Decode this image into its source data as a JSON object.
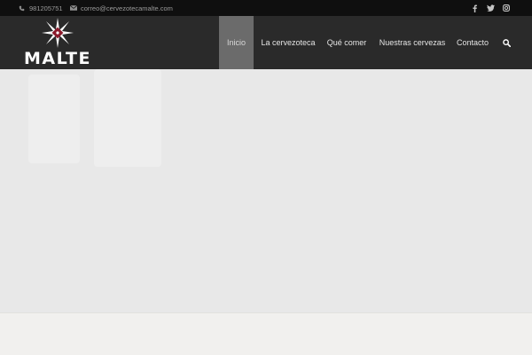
{
  "topbar": {
    "phone": "981205751",
    "email": "correo@cervezotecamalte.com",
    "social": [
      "facebook-icon",
      "twitter-icon",
      "instagram-icon"
    ]
  },
  "header": {
    "logo_text": "MALTE",
    "nav": [
      {
        "label": "Inicio",
        "active": true
      },
      {
        "label": "La cervezoteca",
        "active": false
      },
      {
        "label": "Qué comer",
        "active": false
      },
      {
        "label": "Nuestras cervezas",
        "active": false
      },
      {
        "label": "Contacto",
        "active": false
      }
    ],
    "search_icon": "search-icon"
  },
  "colors": {
    "topbar_bg": "#0f0f0f",
    "header_bg": "#2a2a2a",
    "nav_active_bg": "#6b6b6b",
    "logo_accent": "#8b1a2b",
    "hero_bg": "#e8e8e8"
  }
}
